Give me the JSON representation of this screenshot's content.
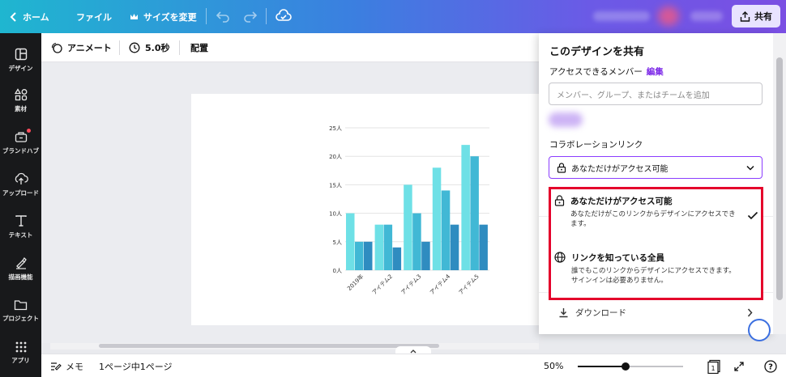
{
  "topbar": {
    "home_label": "ホーム",
    "file_label": "ファイル",
    "resize_label": "サイズを変更",
    "share_label": "共有"
  },
  "sidebar": {
    "items": [
      {
        "label": "デザイン",
        "icon": "layout-icon"
      },
      {
        "label": "素材",
        "icon": "shapes-icon"
      },
      {
        "label": "ブランドハブ",
        "icon": "brand-icon"
      },
      {
        "label": "アップロード",
        "icon": "upload-icon"
      },
      {
        "label": "テキスト",
        "icon": "text-icon"
      },
      {
        "label": "描画機能",
        "icon": "draw-icon"
      },
      {
        "label": "プロジェクト",
        "icon": "folder-icon"
      },
      {
        "label": "アプリ",
        "icon": "apps-icon"
      }
    ]
  },
  "subbar": {
    "animate_label": "アニメート",
    "duration_label": "5.0秒",
    "position_label": "配置"
  },
  "chart_data": {
    "type": "bar",
    "categories": [
      "2019年",
      "アイテム2",
      "アイテム3",
      "アイテム4",
      "アイテム5"
    ],
    "series": [
      {
        "values": [
          10,
          8,
          15,
          18,
          22
        ],
        "color": "#6ee0e6"
      },
      {
        "values": [
          5,
          8,
          10,
          14,
          20
        ],
        "color": "#41b8d5"
      },
      {
        "values": [
          5,
          4,
          5,
          8,
          8
        ],
        "color": "#2f8cc0"
      }
    ],
    "ylim": [
      0,
      25
    ],
    "yticks": [
      "0人",
      "5人",
      "10人",
      "15人",
      "20人",
      "25人"
    ],
    "grid": true
  },
  "bottombar": {
    "notes_label": "メモ",
    "page_info": "1ページ中1ページ",
    "zoom": "50%",
    "zoom_fraction": 0.45,
    "page_count": "1",
    "help_label": "?"
  },
  "share_panel": {
    "title": "このデザインを共有",
    "access_label": "アクセスできるメンバー",
    "edit_label": "編集",
    "input_placeholder": "メンバー、グループ、またはチームを追加",
    "collab_label": "コラボレーションリンク",
    "selected_access": "あなただけがアクセス可能",
    "download_label": "ダウンロード"
  },
  "dropdown": {
    "options": [
      {
        "title": "あなただけがアクセス可能",
        "desc": "あなただけがこのリンクからデザインにアクセスできます。",
        "selected": true
      },
      {
        "title": "リンクを知っている全員",
        "desc": "誰でもこのリンクからデザインにアクセスできます。サインインは必要ありません。",
        "selected": false
      }
    ]
  },
  "colors": {
    "accent": "#7d2ae8",
    "highlight": "#e4002b",
    "sidebar_bg": "#18191b"
  }
}
